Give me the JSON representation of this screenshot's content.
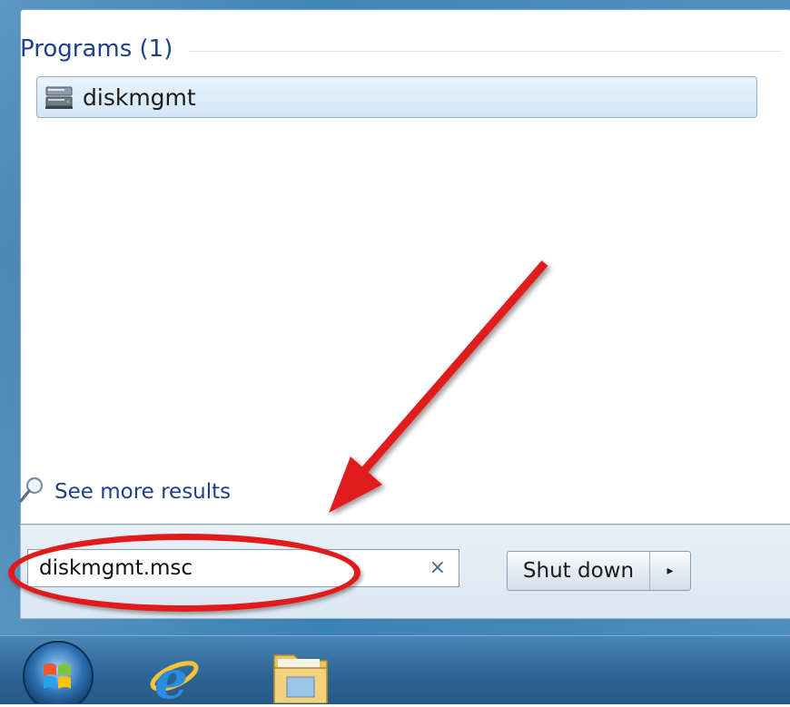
{
  "programs": {
    "header": "Programs (1)",
    "items": [
      {
        "label": "diskmgmt",
        "icon": "disk-management-icon"
      }
    ]
  },
  "see_more": {
    "label": "See more results",
    "icon": "magnifier-icon"
  },
  "search": {
    "value": "diskmgmt.msc",
    "clear_glyph": "×"
  },
  "shutdown": {
    "label": "Shut down",
    "arrow_glyph": "▸"
  },
  "taskbar": {
    "items": [
      "start-orb",
      "internet-explorer-icon",
      "windows-explorer-icon"
    ]
  },
  "colors": {
    "accent_blue": "#1e3f8a",
    "annotation_red": "#e11b1b",
    "taskbar": "#2d6596"
  }
}
